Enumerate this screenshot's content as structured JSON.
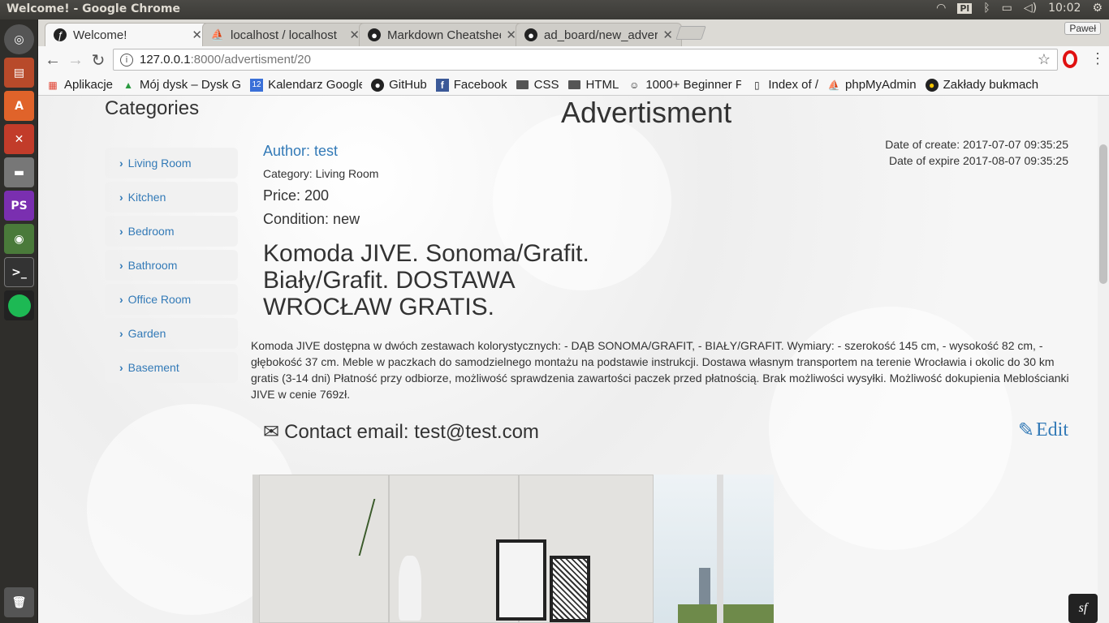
{
  "system": {
    "window_title": "Welcome! - Google Chrome",
    "keyboard_layout": "Pl",
    "clock": "10:02"
  },
  "launcher": [
    {
      "name": "dash-icon",
      "color": "#4a4a4a"
    },
    {
      "name": "files-icon",
      "color": "#b84a2a"
    },
    {
      "name": "software-center-icon",
      "color": "#e0632a"
    },
    {
      "name": "system-settings-icon",
      "color": "#c23c2a"
    },
    {
      "name": "drive-icon",
      "color": "#666666"
    },
    {
      "name": "phpstorm-icon",
      "color": "#a83ad0"
    },
    {
      "name": "chrome-icon",
      "color": "#4a7a3a"
    },
    {
      "name": "terminal-icon",
      "color": "#333333"
    },
    {
      "name": "spotify-icon",
      "color": "#1db954"
    }
  ],
  "tabs": [
    {
      "label": "Welcome!",
      "icon": "symfony-icon",
      "active": true
    },
    {
      "label": "localhost / localhost",
      "icon": "pma-icon",
      "active": false
    },
    {
      "label": "Markdown Cheatsheet",
      "icon": "github-icon",
      "active": false
    },
    {
      "label": "ad_board/new_advert",
      "icon": "github-icon",
      "active": false
    }
  ],
  "profile_name": "Paweł",
  "address": {
    "host": "127.0.0.1",
    "path": ":8000/advertisment/20"
  },
  "bookmarks": [
    {
      "label": "Aplikacje",
      "icon": "apps-icon"
    },
    {
      "label": "Mój dysk – Dysk G",
      "icon": "drive-icon"
    },
    {
      "label": "Kalendarz Google",
      "icon": "calendar-icon"
    },
    {
      "label": "GitHub",
      "icon": "github-icon"
    },
    {
      "label": "Facebook",
      "icon": "facebook-icon"
    },
    {
      "label": "CSS",
      "icon": "folder-icon"
    },
    {
      "label": "HTML",
      "icon": "folder-icon"
    },
    {
      "label": "1000+ Beginner P",
      "icon": "beginner-icon"
    },
    {
      "label": "Index of /",
      "icon": "page-icon"
    },
    {
      "label": "phpMyAdmin",
      "icon": "pma-icon"
    },
    {
      "label": "Zakłady bukmach",
      "icon": "betting-icon"
    }
  ],
  "sidebar": {
    "title": "Categories",
    "items": [
      {
        "label": "Living Room"
      },
      {
        "label": "Kitchen"
      },
      {
        "label": "Bedroom"
      },
      {
        "label": "Bathroom"
      },
      {
        "label": "Office Room"
      },
      {
        "label": "Garden"
      },
      {
        "label": "Basement"
      }
    ]
  },
  "advert": {
    "page_title": "Advertisment",
    "author": "Author: test",
    "date_create": "Date of create: 2017-07-07 09:35:25",
    "date_expire": "Date of expire 2017-08-07 09:35:25",
    "category": "Category: Living Room",
    "price": "Price: 200",
    "condition": "Condition: new",
    "headline": "Komoda JIVE. Sonoma/Grafit. Biały/Grafit. DOSTAWA WROCŁAW GRATIS.",
    "description": "Komoda JIVE dostępna w dwóch zestawach kolorystycznych: - DĄB SONOMA/GRAFIT, - BIAŁY/GRAFIT. Wymiary: - szerokość 145 cm, - wysokość 82 cm, - głębokość 37 cm. Meble w paczkach do samodzielnego montażu na podstawie instrukcji. Dostawa własnym transportem na terenie Wrocławia i okolic do 30 km gratis (3-14 dni) Płatność przy odbiorze, możliwość sprawdzenia zawartości paczek przed płatnością. Brak możliwości wysyłki. Możliwość dokupienia Meblościanki JIVE w cenie 769zł.",
    "contact": "Contact email: test@test.com",
    "edit": "Edit"
  },
  "colors": {
    "link": "#337ab7",
    "text": "#333333"
  }
}
